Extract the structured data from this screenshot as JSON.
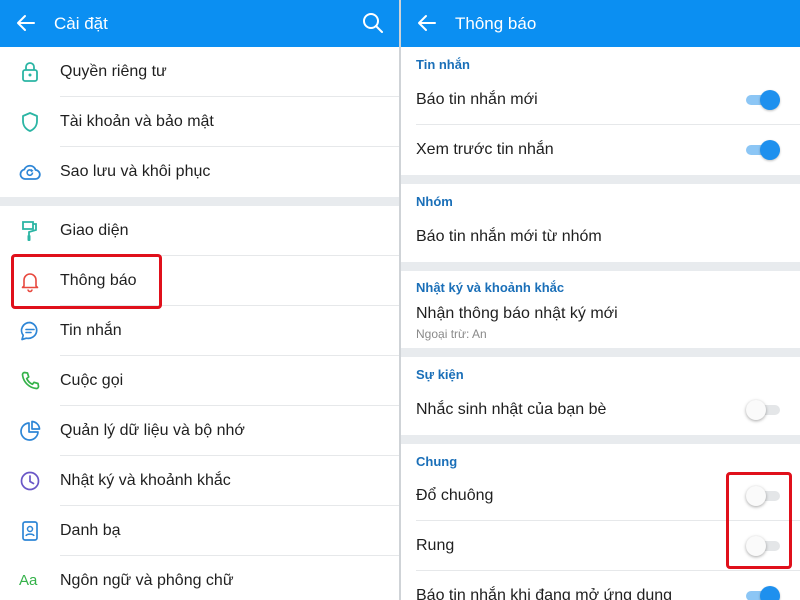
{
  "left_screen": {
    "header": {
      "title": "Cài đặt"
    },
    "items": [
      {
        "label": "Quyền riêng tư",
        "icon": "lock-icon"
      },
      {
        "label": "Tài khoản và bảo mật",
        "icon": "shield-icon"
      },
      {
        "label": "Sao lưu và khôi phục",
        "icon": "cloud-backup-icon"
      },
      {
        "label": "Giao diện",
        "icon": "paint-brush-icon"
      },
      {
        "label": "Thông báo",
        "icon": "bell-icon",
        "highlighted": true
      },
      {
        "label": "Tin nhắn",
        "icon": "chat-bubble-icon"
      },
      {
        "label": "Cuộc gọi",
        "icon": "phone-icon"
      },
      {
        "label": "Quản lý dữ liệu và bộ nhớ",
        "icon": "pie-chart-icon"
      },
      {
        "label": "Nhật ký và khoảnh khắc",
        "icon": "clock-icon"
      },
      {
        "label": "Danh bạ",
        "icon": "contact-card-icon"
      },
      {
        "label": "Ngôn ngữ và phông chữ",
        "icon": "font-aa-icon",
        "icon_text": "Aa"
      }
    ]
  },
  "right_screen": {
    "header": {
      "title": "Thông báo"
    },
    "sections": {
      "tin_nhan": {
        "title": "Tin nhắn",
        "rows": [
          {
            "label": "Báo tin nhắn mới",
            "toggle_on": true
          },
          {
            "label": "Xem trước tin nhắn",
            "toggle_on": true
          }
        ]
      },
      "nhom": {
        "title": "Nhóm",
        "rows": [
          {
            "label": "Báo tin nhắn mới từ nhóm"
          }
        ]
      },
      "nhat_ky": {
        "title": "Nhật ký và khoảnh khắc",
        "rows": [
          {
            "label": "Nhận thông báo nhật ký mới",
            "sublabel": "Ngoại trừ: An"
          }
        ]
      },
      "su_kien": {
        "title": "Sự kiện",
        "rows": [
          {
            "label": "Nhắc sinh nhật của bạn bè",
            "toggle_on": false
          }
        ]
      },
      "chung": {
        "title": "Chung",
        "rows": [
          {
            "label": "Đổ chuông",
            "toggle_on": false,
            "highlighted": true
          },
          {
            "label": "Rung",
            "toggle_on": false,
            "highlighted": true
          },
          {
            "label": "Báo tin nhắn khi đang mở ứng dụng",
            "toggle_on": true
          }
        ]
      }
    }
  },
  "colors": {
    "header_bg": "#0b8ff2",
    "section_title": "#1a6fb8",
    "toggle_on": "#1e90ee",
    "highlight_border": "#e0101b",
    "icon_teal": "#2bb5a4",
    "icon_blue": "#2e86d6",
    "icon_red": "#e8493f",
    "icon_green": "#35b24a",
    "icon_purple": "#6a57c7"
  }
}
